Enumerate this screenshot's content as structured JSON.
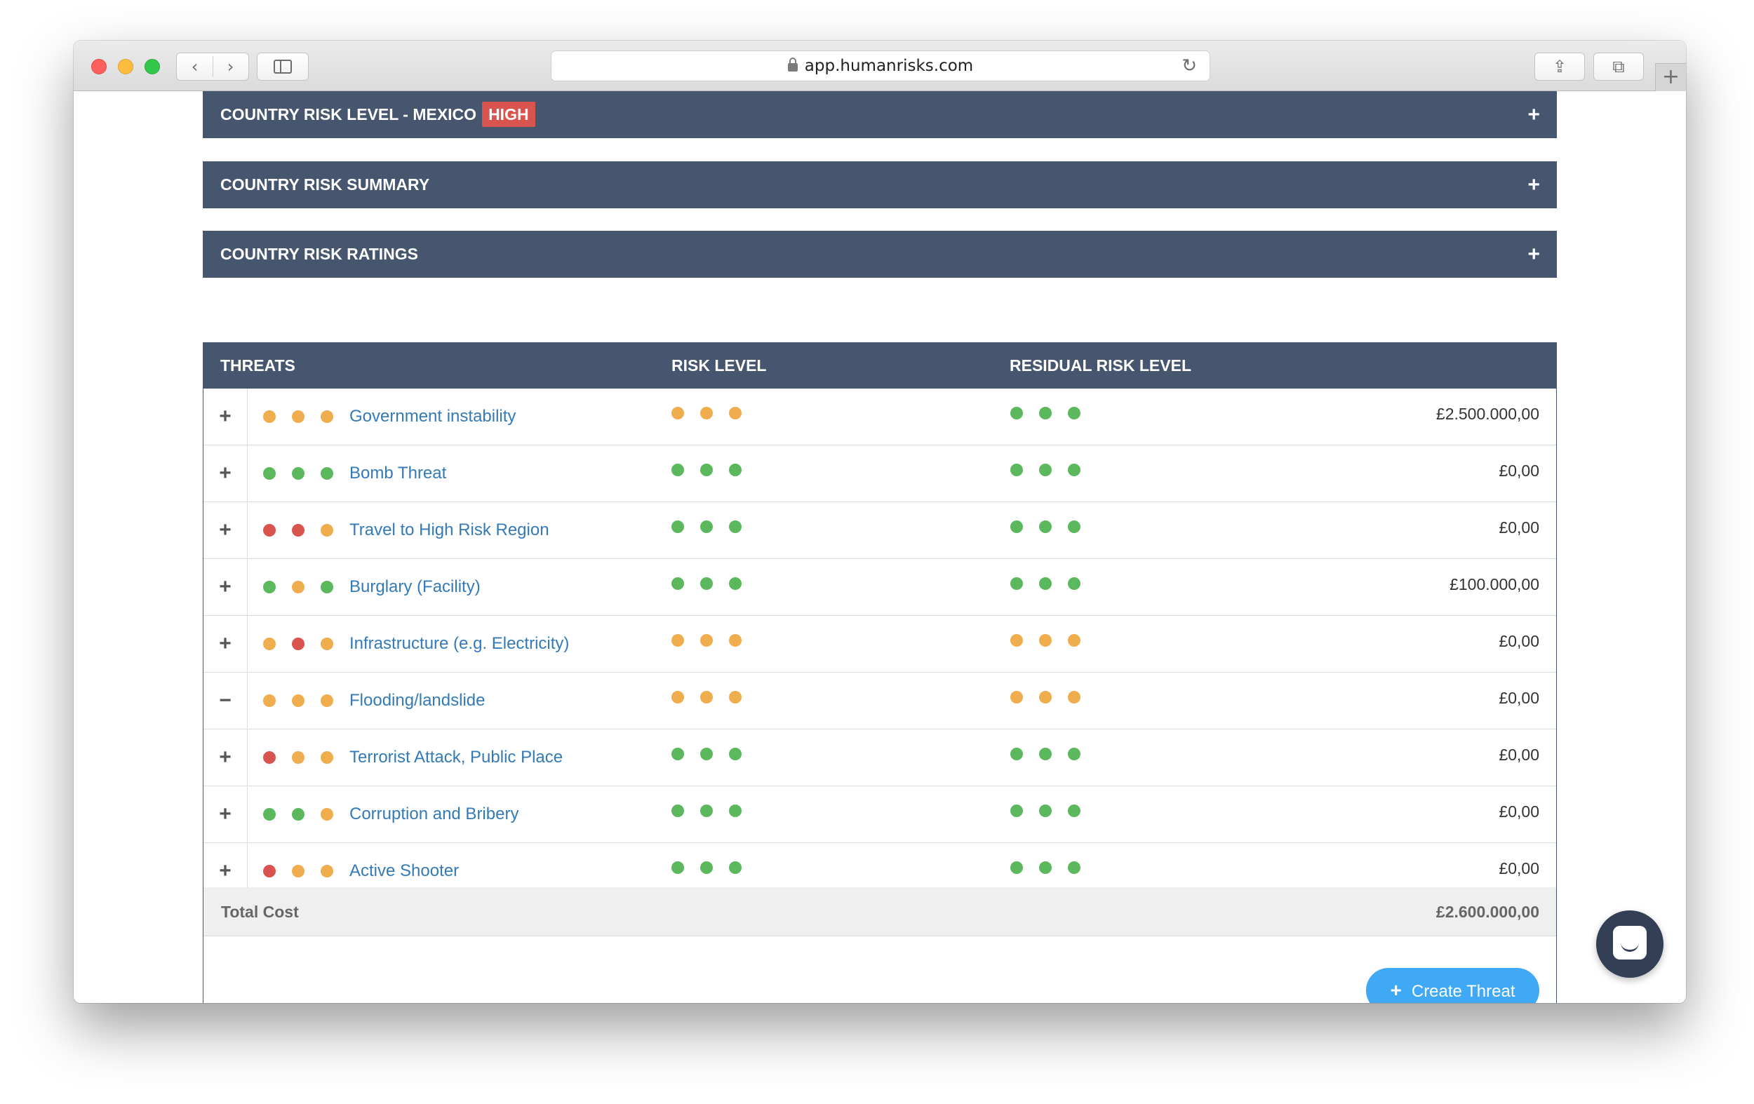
{
  "browser": {
    "url": "app.humanrisks.com",
    "back_glyph": "‹",
    "forward_glyph": "›",
    "reload_glyph": "↻",
    "share_glyph": "⇪",
    "tabs_glyph": "⧉",
    "newtab_glyph": "+"
  },
  "panels": [
    {
      "title": "COUNTRY RISK LEVEL - MEXICO",
      "badge": "HIGH",
      "toggle": "+"
    },
    {
      "title": "COUNTRY RISK SUMMARY",
      "toggle": "+"
    },
    {
      "title": "COUNTRY RISK RATINGS",
      "toggle": "+"
    }
  ],
  "table": {
    "headers": {
      "threats": "THREATS",
      "risk_level": "RISK LEVEL",
      "residual_risk_level": "RESIDUAL RISK LEVEL"
    },
    "colors": {
      "green": "#5cb85c",
      "orange": "#f0ad4e",
      "red": "#d9534f"
    },
    "rows": [
      {
        "toggle": "+",
        "name": "Government instability",
        "threat_dots": [
          "orange",
          "orange",
          "orange"
        ],
        "risk_dots": [
          "orange",
          "orange",
          "orange"
        ],
        "residual_dots": [
          "green",
          "green",
          "green"
        ],
        "cost": "£2.500.000,00"
      },
      {
        "toggle": "+",
        "name": "Bomb Threat",
        "threat_dots": [
          "green",
          "green",
          "green"
        ],
        "risk_dots": [
          "green",
          "green",
          "green"
        ],
        "residual_dots": [
          "green",
          "green",
          "green"
        ],
        "cost": "£0,00"
      },
      {
        "toggle": "+",
        "name": "Travel to High Risk Region",
        "threat_dots": [
          "red",
          "red",
          "orange"
        ],
        "risk_dots": [
          "green",
          "green",
          "green"
        ],
        "residual_dots": [
          "green",
          "green",
          "green"
        ],
        "cost": "£0,00"
      },
      {
        "toggle": "+",
        "name": "Burglary (Facility)",
        "threat_dots": [
          "green",
          "orange",
          "green"
        ],
        "risk_dots": [
          "green",
          "green",
          "green"
        ],
        "residual_dots": [
          "green",
          "green",
          "green"
        ],
        "cost": "£100.000,00"
      },
      {
        "toggle": "+",
        "name": "Infrastructure (e.g. Electricity)",
        "threat_dots": [
          "orange",
          "red",
          "orange"
        ],
        "risk_dots": [
          "orange",
          "orange",
          "orange"
        ],
        "residual_dots": [
          "orange",
          "orange",
          "orange"
        ],
        "cost": "£0,00"
      },
      {
        "toggle": "−",
        "name": "Flooding/landslide",
        "threat_dots": [
          "orange",
          "orange",
          "orange"
        ],
        "risk_dots": [
          "orange",
          "orange",
          "orange"
        ],
        "residual_dots": [
          "orange",
          "orange",
          "orange"
        ],
        "cost": "£0,00"
      },
      {
        "toggle": "+",
        "name": "Terrorist Attack, Public Place",
        "threat_dots": [
          "red",
          "orange",
          "orange"
        ],
        "risk_dots": [
          "green",
          "green",
          "green"
        ],
        "residual_dots": [
          "green",
          "green",
          "green"
        ],
        "cost": "£0,00"
      },
      {
        "toggle": "+",
        "name": "Corruption and Bribery",
        "threat_dots": [
          "green",
          "green",
          "orange"
        ],
        "risk_dots": [
          "green",
          "green",
          "green"
        ],
        "residual_dots": [
          "green",
          "green",
          "green"
        ],
        "cost": "£0,00"
      },
      {
        "toggle": "+",
        "name": "Active Shooter",
        "threat_dots": [
          "red",
          "orange",
          "orange"
        ],
        "risk_dots": [
          "green",
          "green",
          "green"
        ],
        "residual_dots": [
          "green",
          "green",
          "green"
        ],
        "cost": "£0,00"
      }
    ],
    "total": {
      "label": "Total Cost",
      "value": "£2.600.000,00"
    }
  },
  "actions": {
    "create_threat": "Create Threat",
    "create_icon": "+"
  }
}
